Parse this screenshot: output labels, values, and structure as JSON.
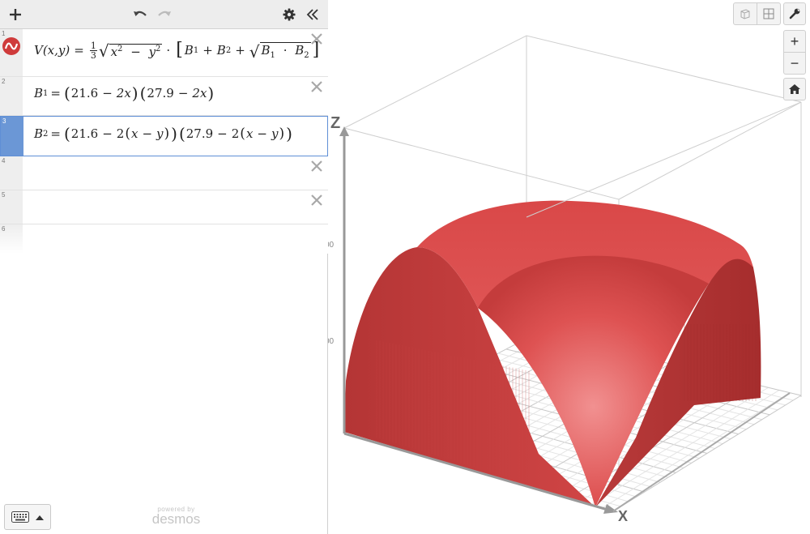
{
  "expressions": {
    "row_numbers": [
      "1",
      "2",
      "3",
      "4",
      "5",
      "6"
    ],
    "e1": {
      "lhs": "V(x,y)",
      "equals": "=",
      "frac_num": "1",
      "frac_den": "3",
      "sqrt_x": "x",
      "sqrt_exp": "2",
      "minus": "−",
      "sqrt_y": "y",
      "dot": "·",
      "B": "B",
      "sub1": "1",
      "sub2": "2",
      "plus": "+"
    },
    "e2": {
      "B": "B",
      "sub": "1",
      "equals": "=",
      "f1a": "21.6",
      "f1b": "2x",
      "f2a": "27.9",
      "f2b": "2x",
      "minus": "−"
    },
    "e3": {
      "B": "B",
      "sub": "2",
      "equals": "=",
      "f1a": "21.6",
      "f2a": "27.9",
      "two": "2",
      "x": "x",
      "y": "y",
      "minus": "−"
    }
  },
  "footer": {
    "powered_by": "powered by",
    "brand": "desmos"
  },
  "graph": {
    "axis_labels": {
      "z": "Z",
      "x": "X"
    },
    "z_tick_labels": [
      "00",
      "00"
    ],
    "zoom_in": "+",
    "zoom_out": "−",
    "surface_color": "#d84242",
    "active_color": "#6b97d6"
  },
  "icons": {
    "add": "plus-icon",
    "undo": "undo-icon",
    "redo": "redo-icon",
    "settings": "gear-icon",
    "collapse": "double-chevron-left-icon",
    "wrench": "wrench-icon",
    "home": "home-icon",
    "keyboard": "keyboard-icon"
  }
}
